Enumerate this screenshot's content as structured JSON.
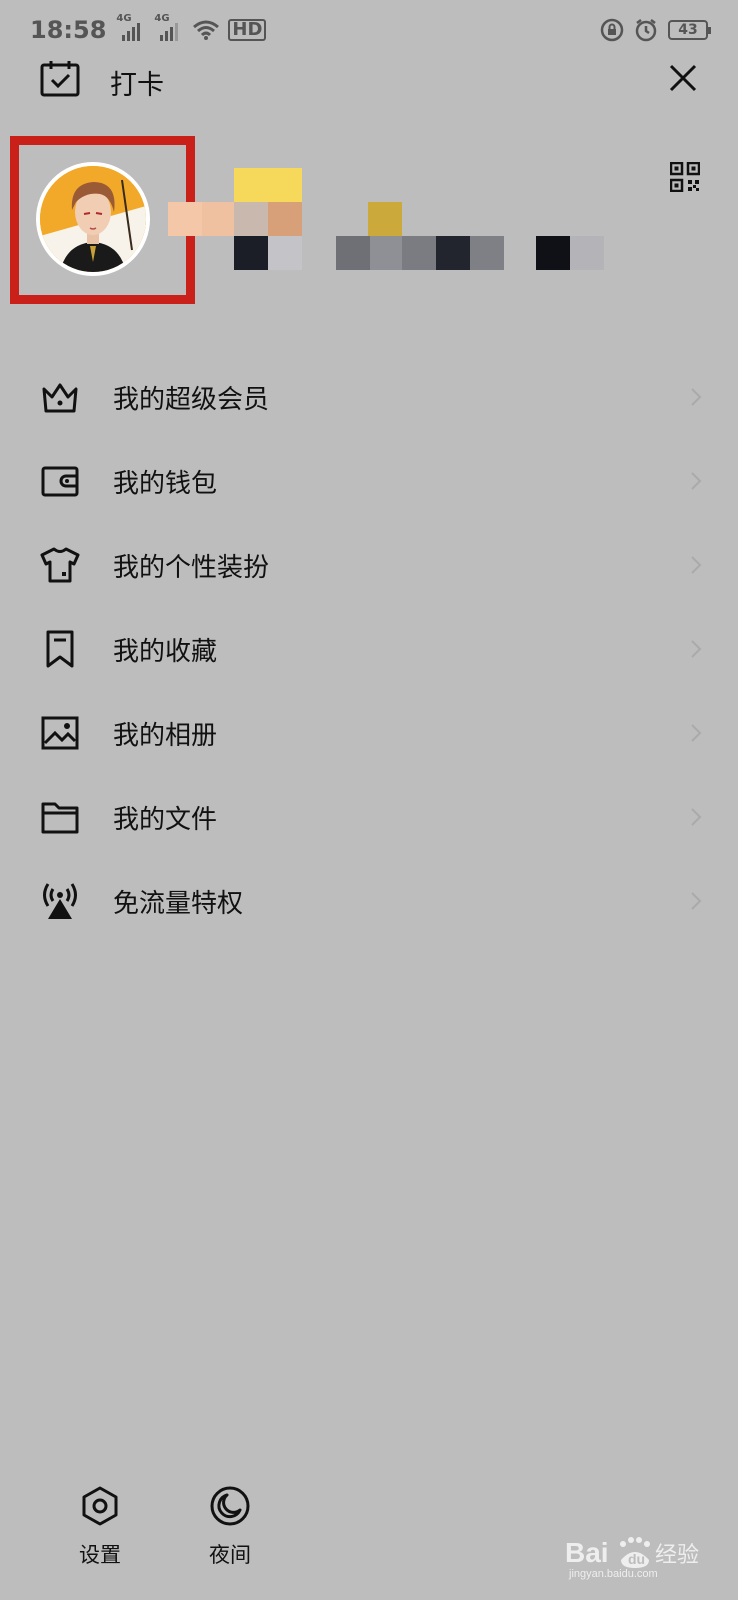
{
  "status_bar": {
    "time": "18:58",
    "net1": "4G",
    "net2": "4G",
    "hd": "HD",
    "battery": "43"
  },
  "header": {
    "checkin_label": "打卡"
  },
  "menu": {
    "items": [
      {
        "label": "我的超级会员",
        "icon": "crown-icon"
      },
      {
        "label": "我的钱包",
        "icon": "wallet-icon"
      },
      {
        "label": "我的个性装扮",
        "icon": "shirt-icon"
      },
      {
        "label": "我的收藏",
        "icon": "bookmark-icon"
      },
      {
        "label": "我的相册",
        "icon": "image-icon"
      },
      {
        "label": "我的文件",
        "icon": "folder-icon"
      },
      {
        "label": "免流量特权",
        "icon": "signal-tower-icon"
      }
    ]
  },
  "bottom": {
    "settings_label": "设置",
    "night_label": "夜间"
  },
  "colors": {
    "background": "#bdbdbd",
    "highlight": "#c9201a",
    "text": "#111111"
  }
}
